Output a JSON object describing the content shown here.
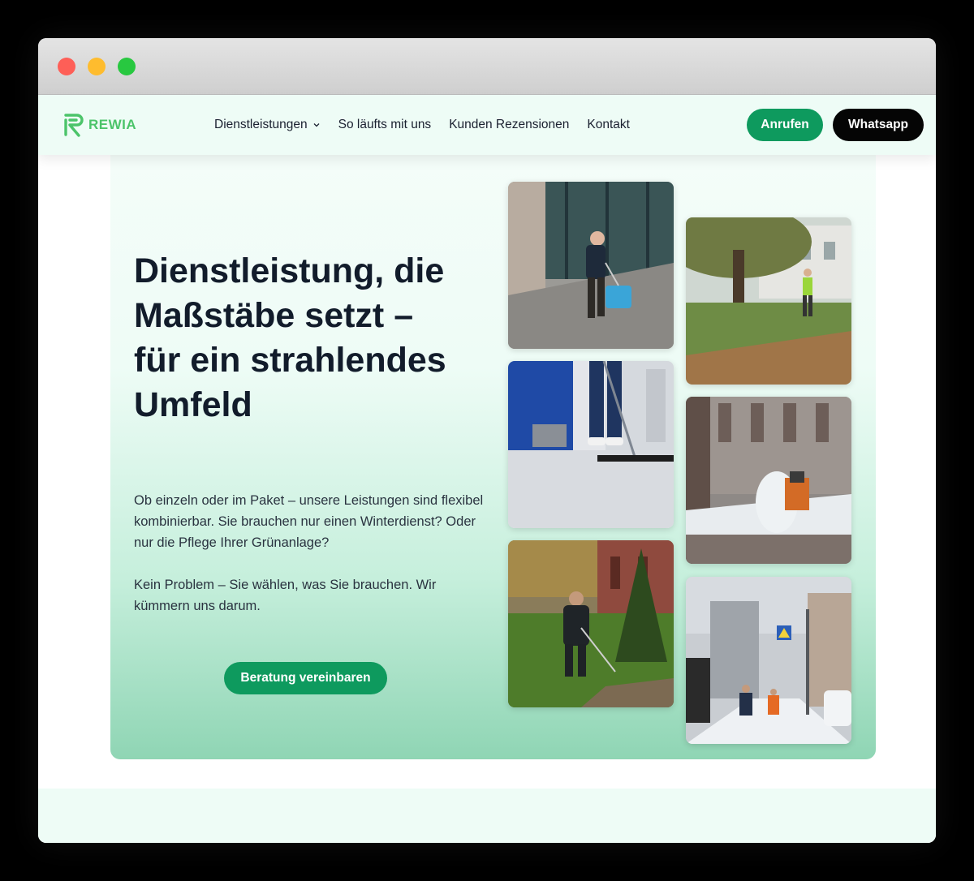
{
  "brand": {
    "name": "REWIA",
    "color": "#4cc46a"
  },
  "nav": {
    "items": [
      {
        "label": "Dienstleistungen",
        "has_dropdown": true
      },
      {
        "label": "So läufts mit uns"
      },
      {
        "label": "Kunden Rezensionen"
      },
      {
        "label": "Kontakt"
      }
    ],
    "call_label": "Anrufen",
    "whatsapp_label": "Whatsapp"
  },
  "hero": {
    "title": "Dienstleistung, die Maßstäbe setzt – für ein strahlendes Umfeld",
    "paragraph_1": "Ob einzeln oder im Paket – unsere Leistungen sind flexibel kombinierbar. Sie brauchen nur einen Winterdienst? Oder nur die Pflege Ihrer Grünanlage?",
    "paragraph_2": "Kein Problem – Sie wählen, was Sie brauchen. Wir kümmern uns darum.",
    "cta_label": "Beratung vereinbaren"
  },
  "colors": {
    "accent": "#0e9a5e",
    "dark_button": "#050505",
    "text": "#121c2b",
    "nav_bg": "#eefcf6"
  },
  "gallery": [
    {
      "subject": "cleaning-worker-with-bucket-photo"
    },
    {
      "subject": "leaf-blower-worker-photo"
    },
    {
      "subject": "floor-mopping-photo"
    },
    {
      "subject": "snow-plow-photo"
    },
    {
      "subject": "hedge-trimming-worker-photo"
    },
    {
      "subject": "snowy-street-photo"
    }
  ]
}
